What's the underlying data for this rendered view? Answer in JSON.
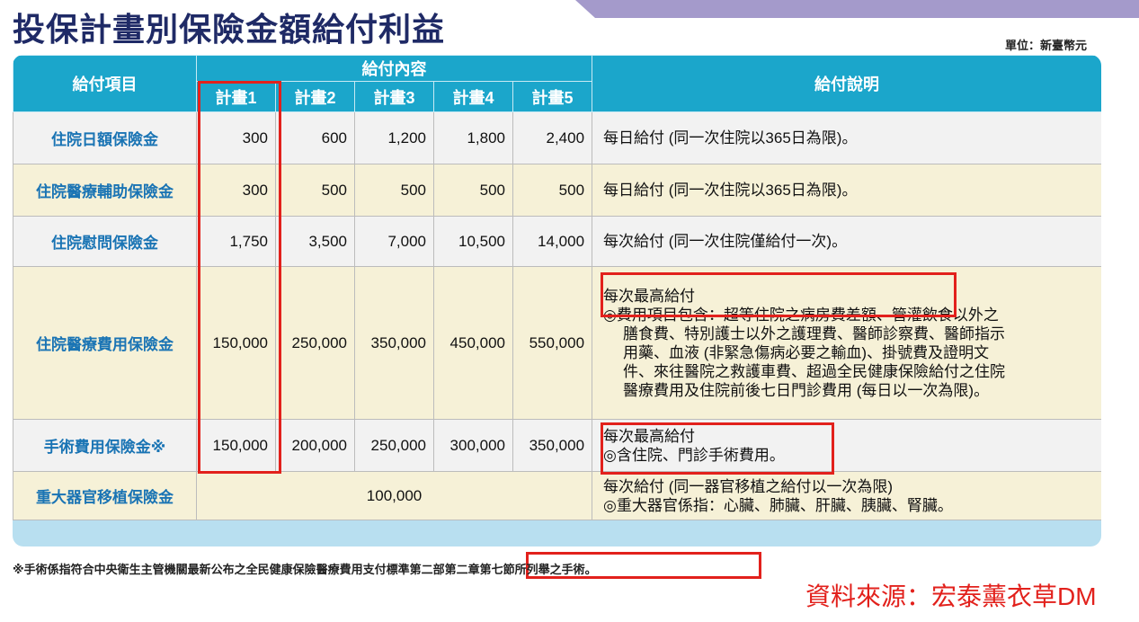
{
  "title": "投保計畫別保險金額給付利益",
  "unit": "單位：新臺幣元",
  "table": {
    "headers": {
      "item": "給付項目",
      "content": "給付內容",
      "description": "給付說明",
      "plans": [
        "計畫1",
        "計畫2",
        "計畫3",
        "計畫4",
        "計畫5"
      ]
    },
    "rows": [
      {
        "name": "住院日額保險金",
        "amounts": [
          "300",
          "600",
          "1,200",
          "1,800",
          "2,400"
        ],
        "desc": [
          "每日給付 (同一次住院以365日為限)。"
        ]
      },
      {
        "name": "住院醫療輔助保險金",
        "amounts": [
          "300",
          "500",
          "500",
          "500",
          "500"
        ],
        "desc": [
          "每日給付 (同一次住院以365日為限)。"
        ]
      },
      {
        "name": "住院慰問保險金",
        "amounts": [
          "1,750",
          "3,500",
          "7,000",
          "10,500",
          "14,000"
        ],
        "desc": [
          "每次給付 (同一次住院僅給付一次)。"
        ]
      },
      {
        "name": "住院醫療費用保險金",
        "amounts": [
          "150,000",
          "250,000",
          "350,000",
          "450,000",
          "550,000"
        ],
        "desc": [
          "每次最高給付",
          "◎費用項目包含：超等住院之病房費差額、管灌飲食以外之",
          "膳食費、特別護士以外之護理費、醫師診察費、醫師指示",
          "用藥、血液 (非緊急傷病必要之輸血)、掛號費及證明文",
          "件、來往醫院之救護車費、超過全民健康保險給付之住院",
          "醫療費用及住院前後七日門診費用 (每日以一次為限)。"
        ]
      },
      {
        "name": "手術費用保險金※",
        "amounts": [
          "150,000",
          "200,000",
          "250,000",
          "300,000",
          "350,000"
        ],
        "desc": [
          "每次最高給付",
          "◎含住院、門診手術費用。"
        ]
      },
      {
        "name": "重大器官移植保險金",
        "amount_all": "100,000",
        "desc": [
          "每次給付 (同一器官移植之給付以一次為限)",
          "◎重大器官係指：心臟、肺臟、肝臟、胰臟、腎臟。"
        ]
      }
    ]
  },
  "footnote": "※手術係指符合中央衛生主管機關最新公布之全民健康保險醫療費用支付標準第二部第二章第七節所列舉之手術。",
  "source": "資料來源：宏泰薰衣草DM",
  "colors": {
    "header_bg": "#1ba6cb",
    "item_text": "#1a74b4",
    "row_gray": "#f2f2f2",
    "row_cream": "#f6f1d7",
    "highlight": "#e2211c",
    "title": "#1f2a66"
  }
}
